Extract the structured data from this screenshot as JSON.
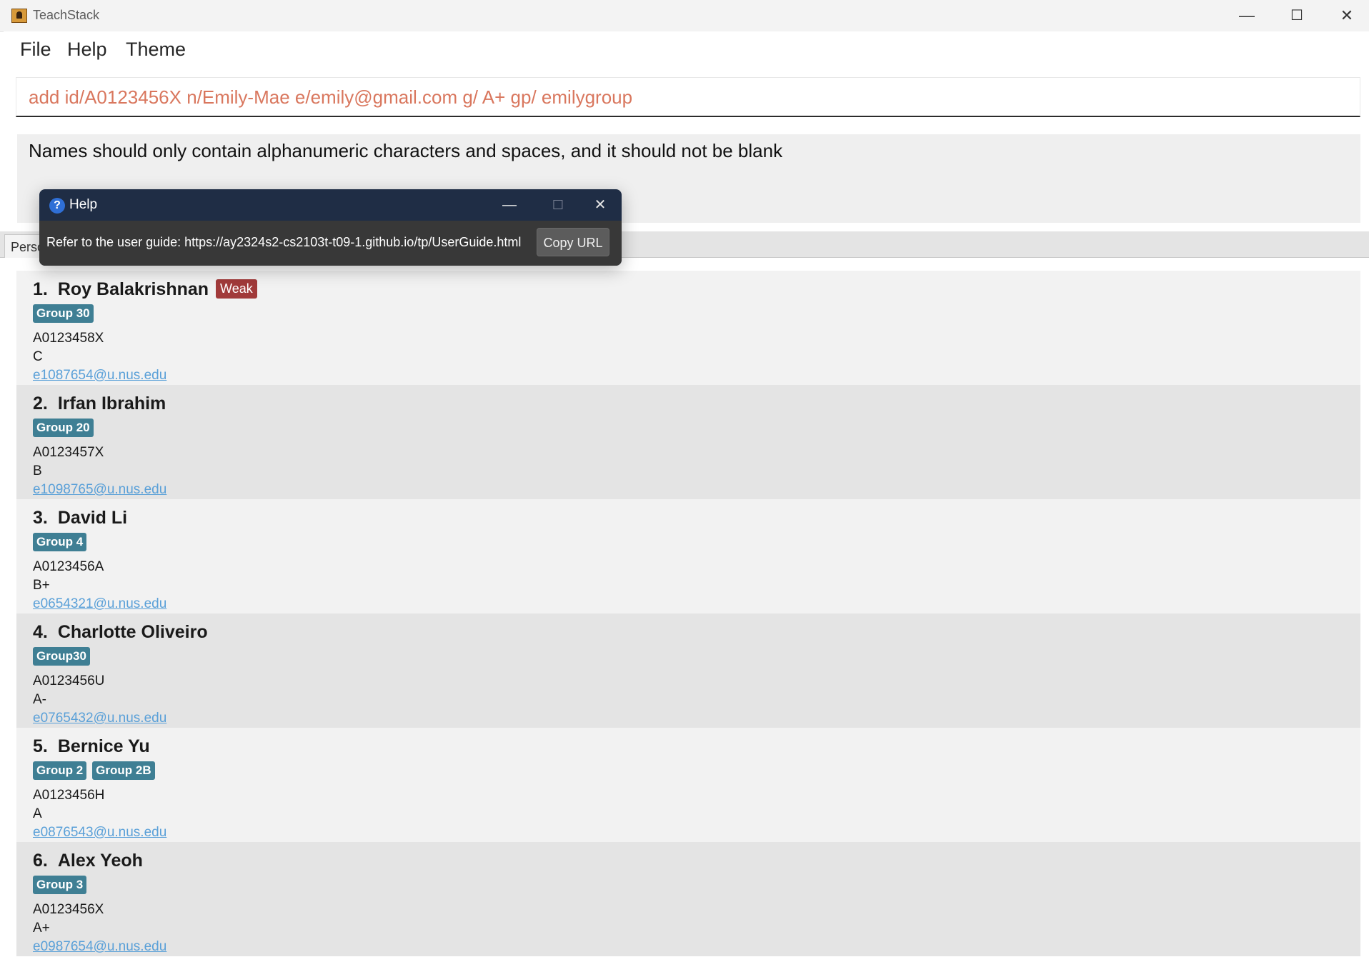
{
  "window": {
    "title": "TeachStack",
    "minimize": "—",
    "maximize": "☐",
    "close": "✕"
  },
  "menu": {
    "items": [
      "File",
      "Help",
      "Theme"
    ]
  },
  "command_box": {
    "value": "add id/A0123456X n/Emily-Mae e/emily@gmail.com g/ A+ gp/ emilygroup"
  },
  "result_display": {
    "text": "Names should only contain alphanumeric characters and spaces, and it should not be blank"
  },
  "tab": {
    "label": "Perso"
  },
  "persons": [
    {
      "index": "1.",
      "name": "Roy Balakrishnan",
      "tag": "Weak",
      "groups": [
        "Group 30"
      ],
      "id": "A0123458X",
      "grade": "C",
      "email": "e1087654@u.nus.edu"
    },
    {
      "index": "2.",
      "name": "Irfan Ibrahim",
      "groups": [
        "Group 20"
      ],
      "id": "A0123457X",
      "grade": "B",
      "email": "e1098765@u.nus.edu"
    },
    {
      "index": "3.",
      "name": "David Li",
      "groups": [
        "Group 4"
      ],
      "id": "A0123456A",
      "grade": "B+",
      "email": "e0654321@u.nus.edu"
    },
    {
      "index": "4.",
      "name": "Charlotte Oliveiro",
      "groups": [
        "Group30"
      ],
      "id": "A0123456U",
      "grade": "A-",
      "email": "e0765432@u.nus.edu"
    },
    {
      "index": "5.",
      "name": "Bernice Yu",
      "groups": [
        "Group 2",
        "Group 2B"
      ],
      "id": "A0123456H",
      "grade": "A",
      "email": "e0876543@u.nus.edu"
    },
    {
      "index": "6.",
      "name": "Alex Yeoh",
      "groups": [
        "Group 3"
      ],
      "id": "A0123456X",
      "grade": "A+",
      "email": "e0987654@u.nus.edu"
    }
  ],
  "help_window": {
    "icon": "?",
    "title": "Help",
    "message": "Refer to the user guide: https://ay2324s2-cs2103t-t09-1.github.io/tp/UserGuide.html",
    "copy_button": "Copy URL",
    "minimize": "—",
    "maximize": "☐",
    "close": "✕"
  },
  "colors": {
    "weak_tag": "#a13a3a",
    "group_tag": "#3f7f94",
    "command_text": "#d9775e",
    "email_link": "#5aa0d8",
    "help_titlebar": "#1f2d45"
  }
}
